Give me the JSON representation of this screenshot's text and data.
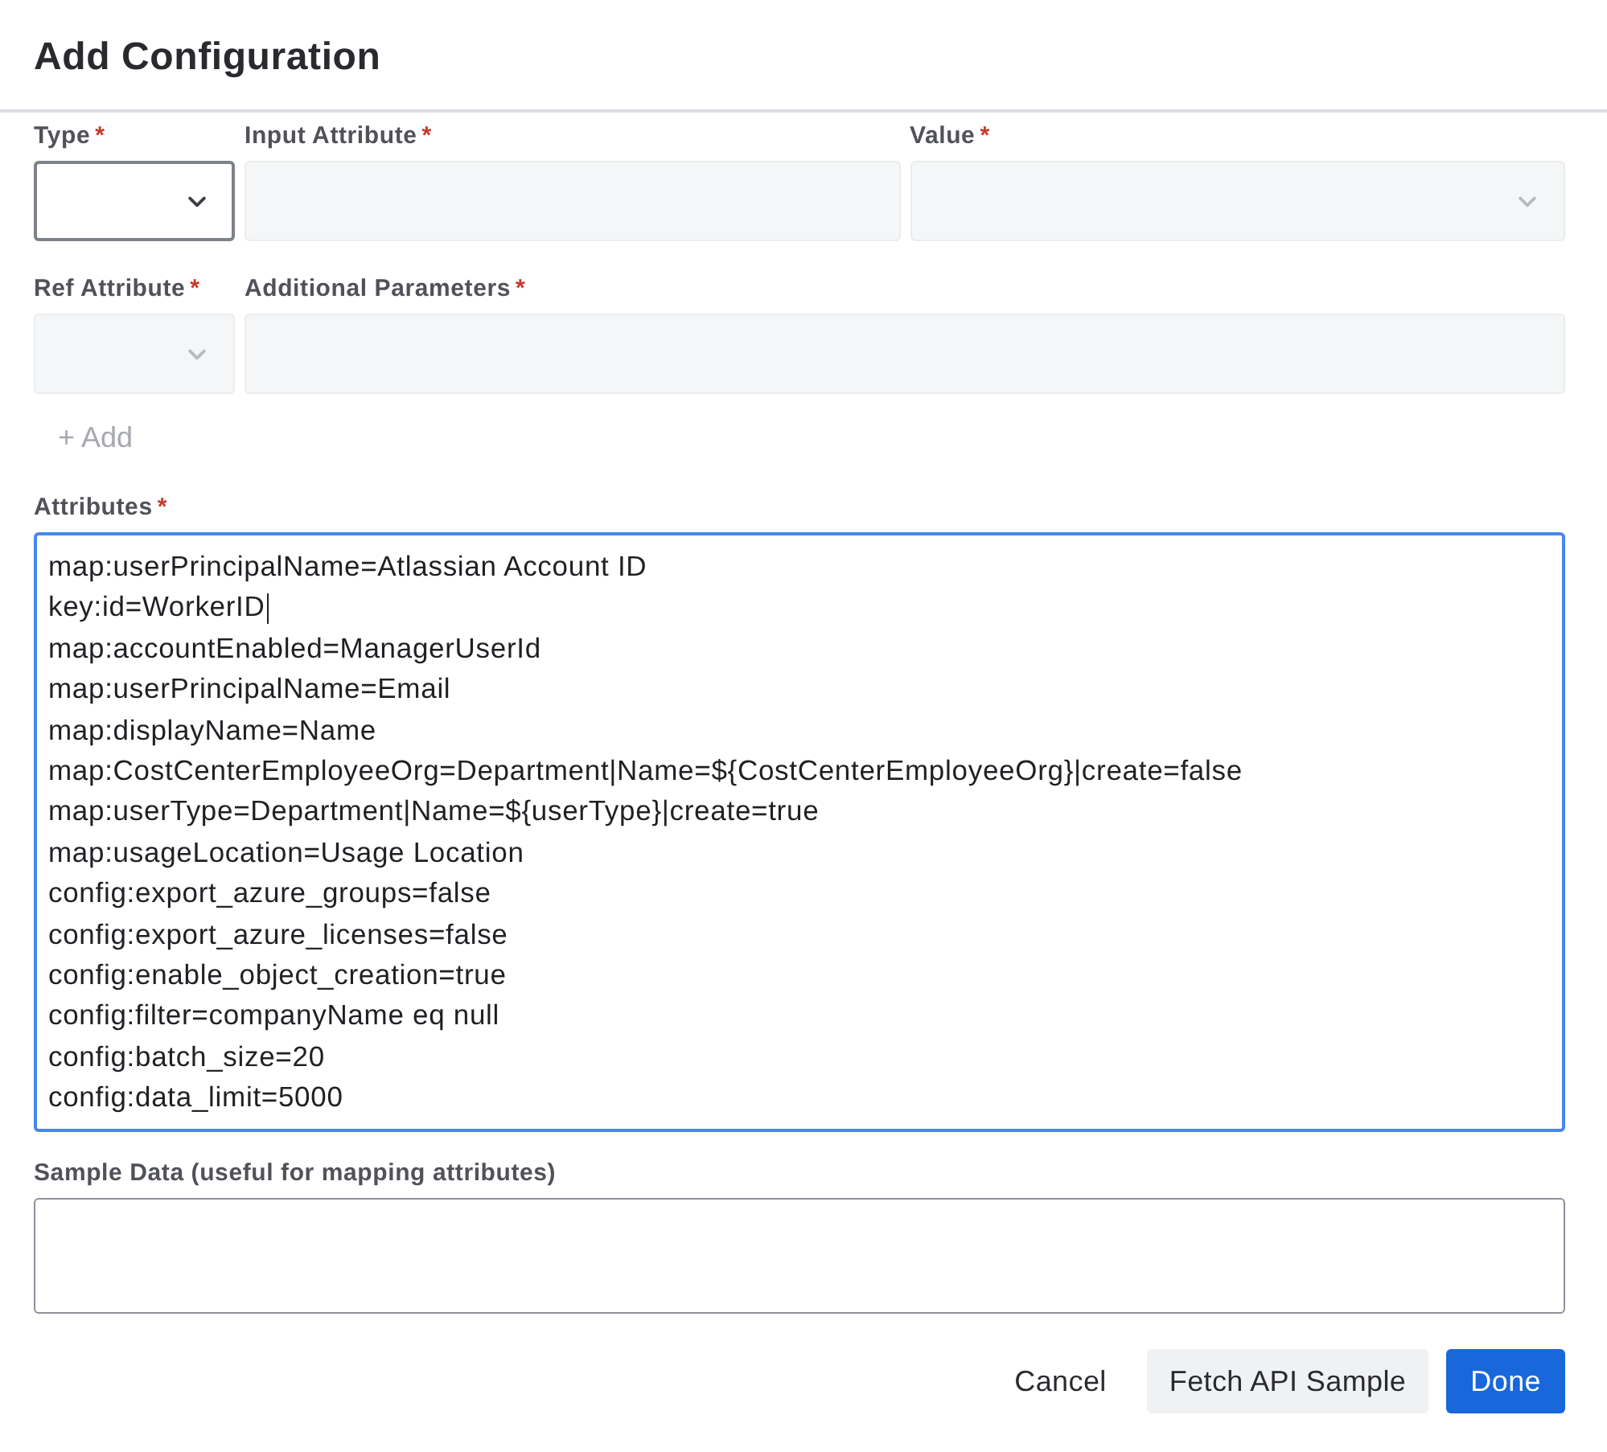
{
  "dialog": {
    "title": "Add Configuration"
  },
  "mapping_rows": [
    {
      "fields": [
        {
          "label": "Type",
          "required_mark": "*",
          "kind": "select",
          "disabled": false
        },
        {
          "label": "Input Attribute",
          "required_mark": "*",
          "kind": "text",
          "disabled": true
        },
        {
          "label": "Value",
          "required_mark": "*",
          "kind": "select",
          "disabled": true
        }
      ]
    },
    {
      "fields": [
        {
          "label": "Ref Attribute",
          "required_mark": "*",
          "kind": "select",
          "disabled": true
        },
        {
          "label": "Additional Parameters",
          "required_mark": "*",
          "kind": "text",
          "disabled": true
        }
      ]
    }
  ],
  "add_button": {
    "label": "+ Add",
    "disabled": true
  },
  "attributes": {
    "label": "Attributes",
    "required_mark": "*",
    "focused": true,
    "lines": [
      {
        "text": "map:userPrincipalName=Atlassian Account ID",
        "caret": false
      },
      {
        "text": "key:id=WorkerID",
        "caret": true
      },
      {
        "text": "map:accountEnabled=ManagerUserId",
        "caret": false
      },
      {
        "text": "map:userPrincipalName=Email",
        "caret": false
      },
      {
        "text": "map:displayName=Name",
        "caret": false
      },
      {
        "text": "map:CostCenterEmployeeOrg=Department|Name=${CostCenterEmployeeOrg}|create=false",
        "caret": false
      },
      {
        "text": "map:userType=Department|Name=${userType}|create=true",
        "caret": false
      },
      {
        "text": "map:usageLocation=Usage Location",
        "caret": false
      },
      {
        "text": "config:export_azure_groups=false",
        "caret": false
      },
      {
        "text": "config:export_azure_licenses=false",
        "caret": false
      },
      {
        "text": "config:enable_object_creation=true",
        "caret": false
      },
      {
        "text": "config:filter=companyName eq null",
        "caret": false
      },
      {
        "text": "config:batch_size=20",
        "caret": false
      },
      {
        "text": "config:data_limit=5000",
        "caret": false
      }
    ]
  },
  "sample_data": {
    "label": "Sample Data (useful for mapping attributes)",
    "focused": false
  },
  "buttons": [
    {
      "label": "Cancel",
      "kind": "subtle"
    },
    {
      "label": "Fetch API Sample",
      "kind": "default"
    },
    {
      "label": "Done",
      "kind": "primary"
    }
  ]
}
